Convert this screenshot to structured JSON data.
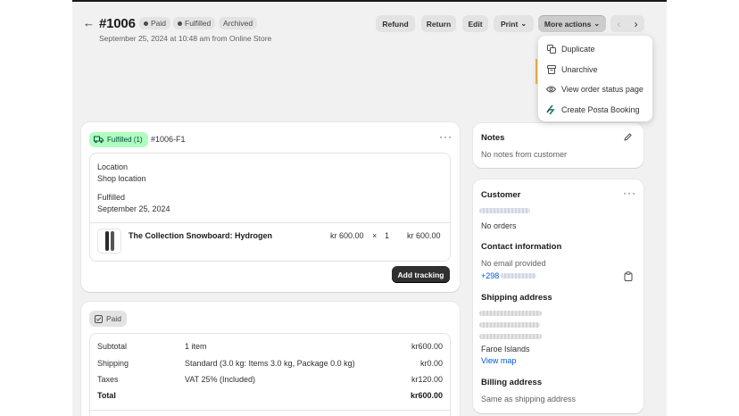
{
  "header": {
    "back_icon": "arrow-left-icon",
    "order_number": "#1006",
    "badges": [
      "Paid",
      "Fulfilled",
      "Archived"
    ],
    "subtitle": "September 25, 2024 at 10:48 am from Online Store"
  },
  "toolbar": {
    "refund": "Refund",
    "return": "Return",
    "edit": "Edit",
    "print": "Print",
    "more_actions": "More actions",
    "prev_icon": "chevron-left-icon",
    "next_icon": "chevron-right-icon"
  },
  "more_actions_menu": {
    "items": [
      {
        "label": "Duplicate",
        "icon": "duplicate-icon"
      },
      {
        "label": "Unarchive",
        "icon": "archive-icon"
      },
      {
        "label": "View order status page",
        "icon": "eye-icon"
      },
      {
        "label": "Create Posta Booking",
        "icon": "posta-app-icon"
      }
    ]
  },
  "fulfillment": {
    "status_badge": "Fulfilled (1)",
    "fulfillment_id": "#1006-F1",
    "location_label": "Location",
    "location_value": "Shop location",
    "fulfilled_label": "Fulfilled",
    "fulfilled_date": "September 25, 2024",
    "line_item": {
      "name": "The Collection Snowboard: Hydrogen",
      "price": "kr 600.00",
      "times": "×",
      "quantity": "1",
      "total": "kr 600.00"
    },
    "add_tracking": "Add tracking"
  },
  "payment": {
    "status_badge": "Paid",
    "rows": [
      {
        "label": "Subtotal",
        "detail": "1 item",
        "amount": "kr600.00"
      },
      {
        "label": "Shipping",
        "detail": "Standard (3.0 kg: Items 3.0 kg, Package 0.0 kg)",
        "amount": "kr0.00"
      },
      {
        "label": "Taxes",
        "detail": "VAT 25% (Included)",
        "amount": "kr120.00"
      },
      {
        "label": "Total",
        "detail": "",
        "amount": "kr600.00"
      }
    ]
  },
  "notes": {
    "title": "Notes",
    "empty": "No notes from customer"
  },
  "customer": {
    "title": "Customer",
    "orders": "No orders",
    "contact_title": "Contact information",
    "email": "No email provided",
    "phone_prefix": "+298",
    "shipping_title": "Shipping address",
    "country": "Faroe Islands",
    "view_map": "View map",
    "billing_title": "Billing address",
    "billing_value": "Same as shipping address"
  },
  "colors": {
    "fulfilled_badge_bg": "#affebf",
    "fulfilled_badge_text": "#014b40",
    "link": "#005bd3",
    "dark_button": "#303030"
  }
}
